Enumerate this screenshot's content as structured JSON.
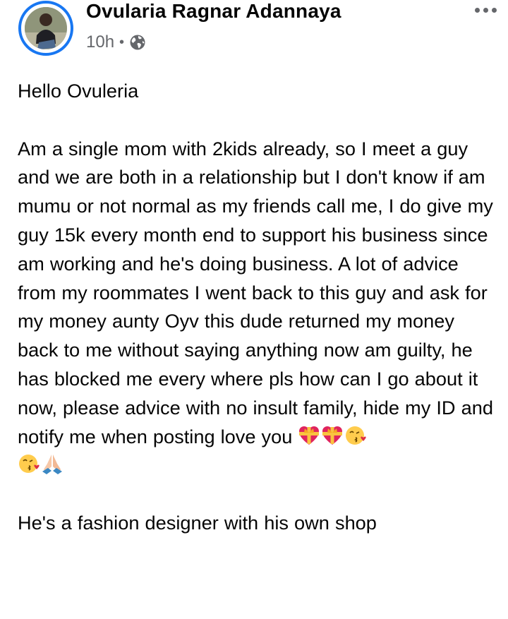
{
  "post": {
    "author": "Ovularia Ragnar Adannaya",
    "timestamp": "10h",
    "separator": "•",
    "privacy_icon": "globe-icon",
    "more_icon": "more-dots-icon",
    "avatar_icon": "profile-photo",
    "greeting": "Hello Ovuleria",
    "message": "Am a single mom with 2kids already,  so I meet a guy and we are both in a relationship but I don't know if am mumu or not normal as my friends call me, I do give my guy 15k every month end to support his business since am working and he's doing business. A lot of advice from my roommates I went back to this guy and ask for my money aunty Oyv this dude returned my money back to me without saying anything now am guilty, he has blocked me every where pls how can I go about it now, please advice with no insult family, hide my ID and notify me when posting love you",
    "message_emojis": [
      "heart-with-ribbon-emoji",
      "heart-with-ribbon-emoji",
      "face-blowing-kiss-emoji",
      "face-blowing-kiss-emoji",
      "folded-hands-emoji"
    ],
    "postscript": "He's a fashion designer with his own shop"
  },
  "colors": {
    "text": "#050505",
    "secondary_text": "#65676b",
    "avatar_ring": "#1877f2",
    "background": "#ffffff"
  }
}
